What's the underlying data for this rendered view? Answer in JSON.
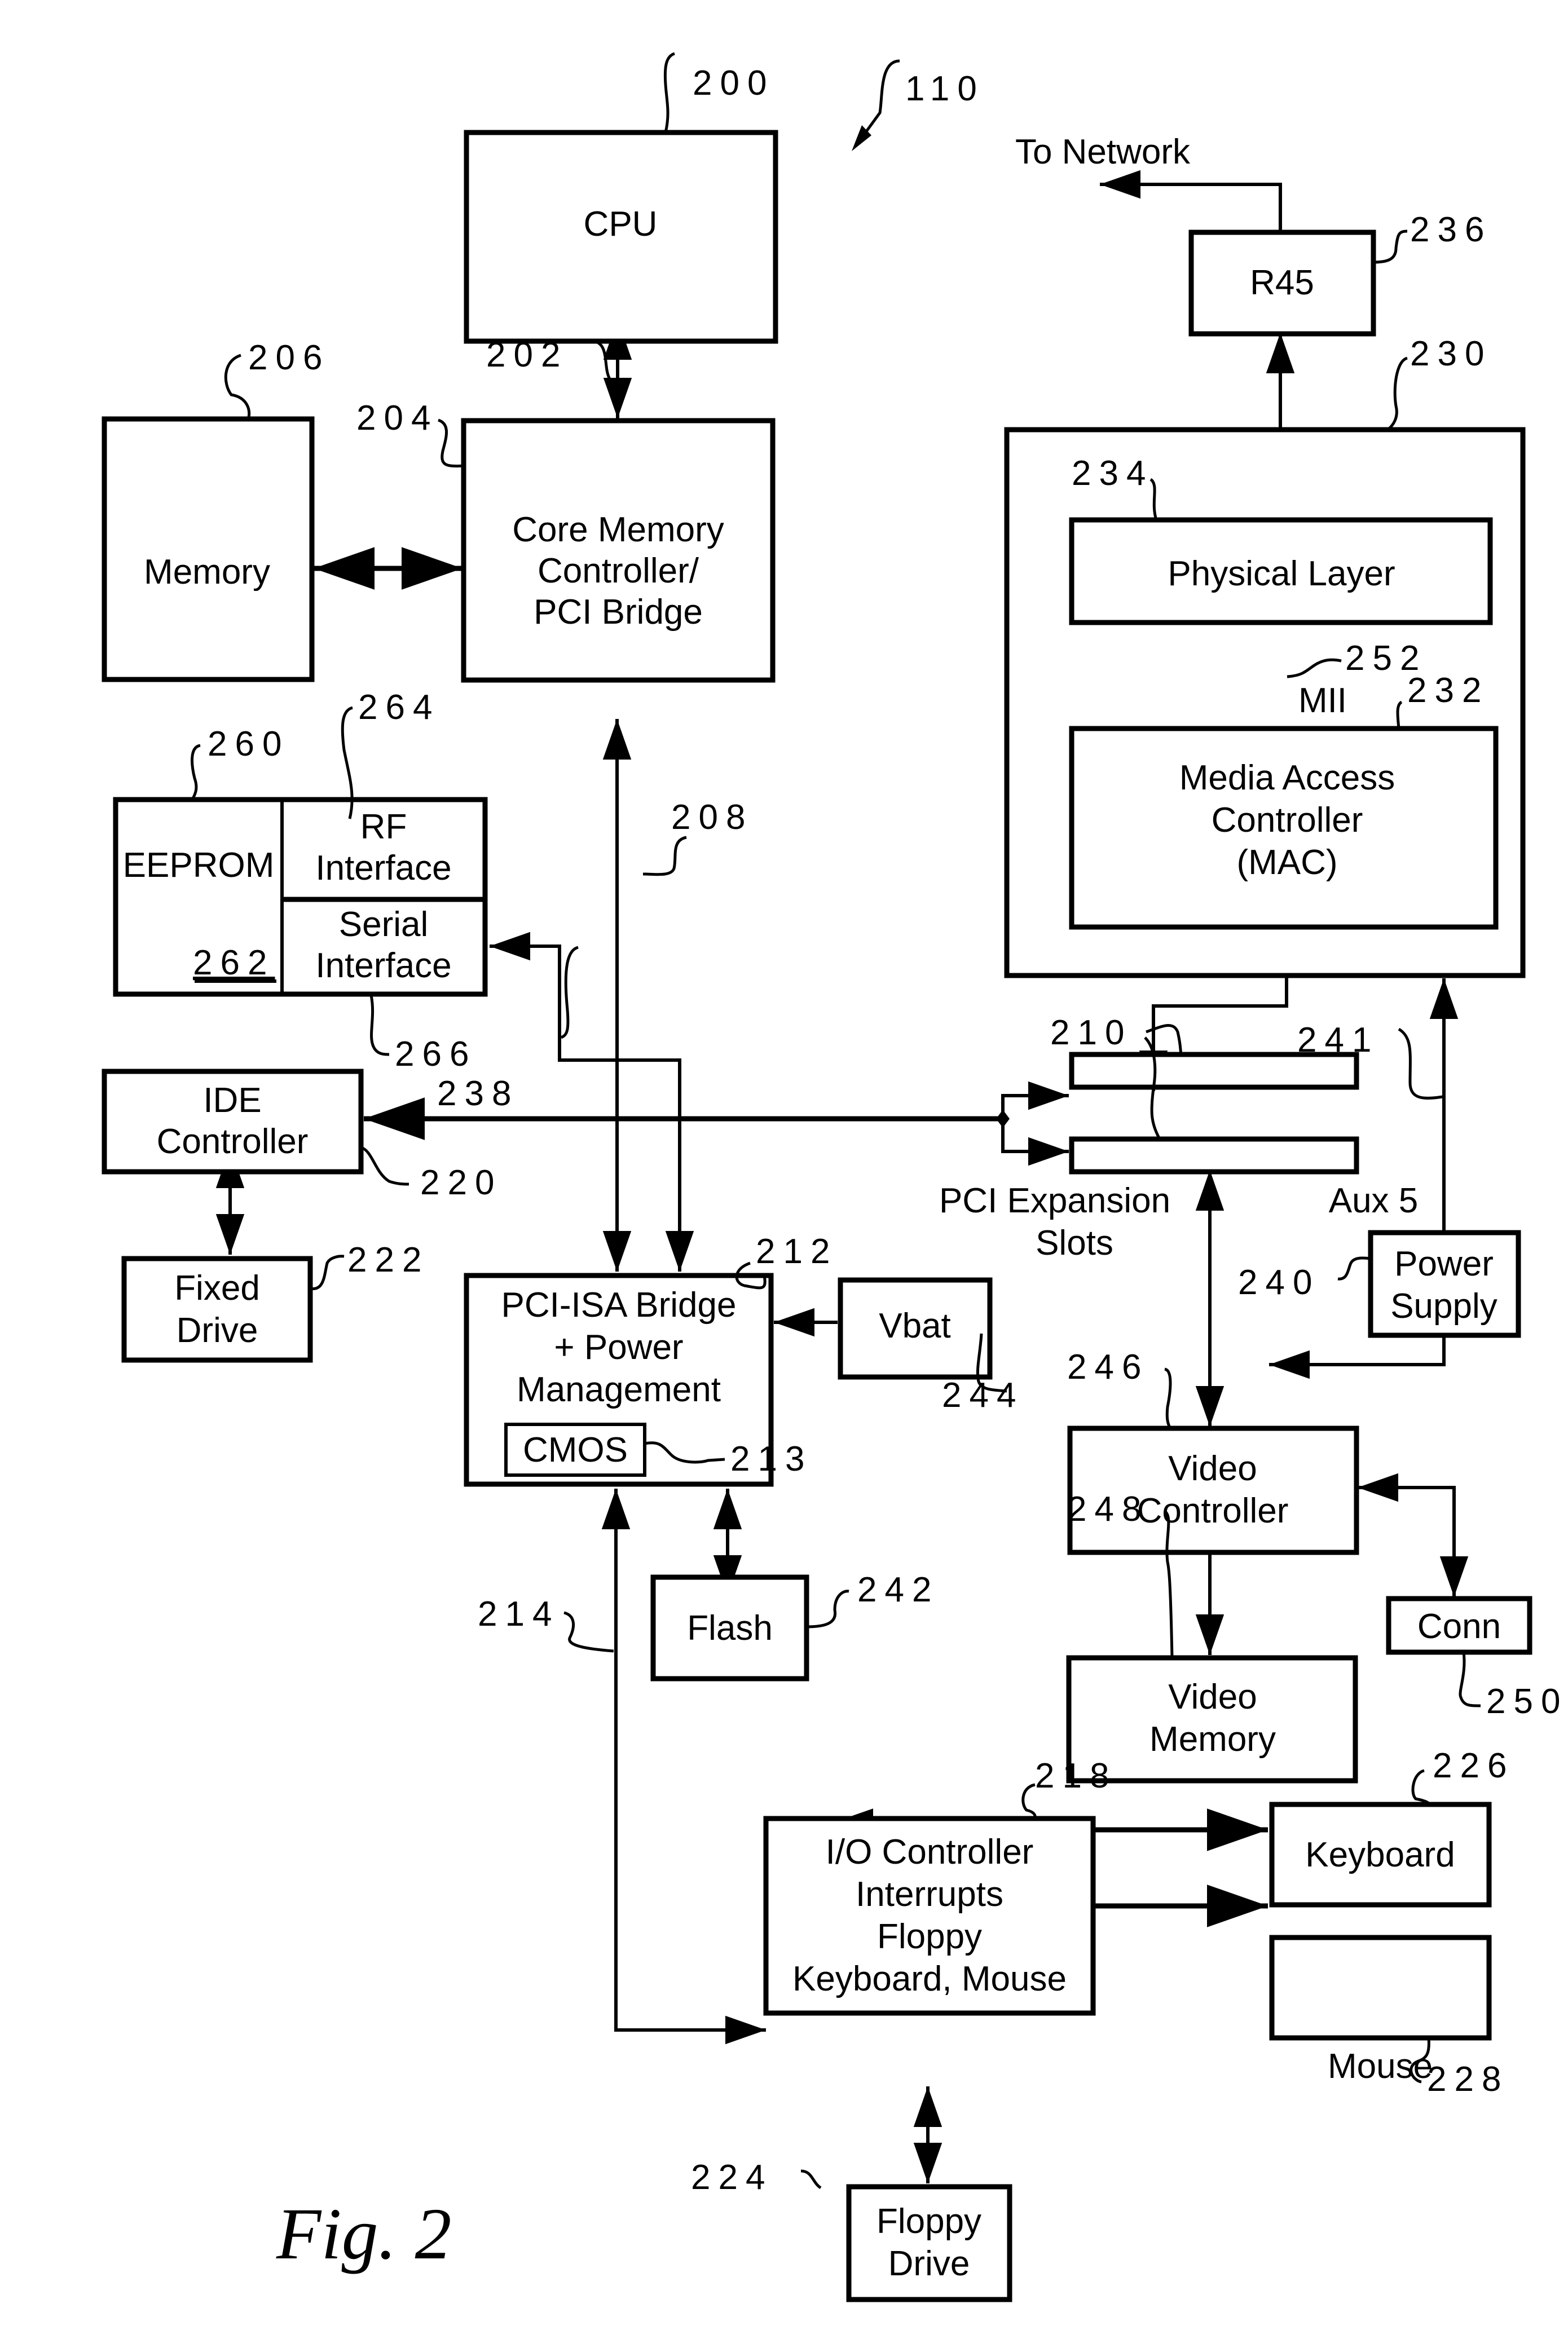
{
  "figure": {
    "caption": "Fig.  2",
    "system_ref": "110"
  },
  "blocks": {
    "cpu": {
      "label": [
        "CPU"
      ],
      "ref": "200"
    },
    "core_memory_controller": {
      "label": [
        "Core Memory",
        "Controller/",
        "PCI Bridge"
      ],
      "ref": "204"
    },
    "memory": {
      "label": [
        "Memory"
      ],
      "ref": "206"
    },
    "eeprom": {
      "label": [
        "EEPROM"
      ],
      "ref": "260",
      "sub_ref": "262"
    },
    "rf_interface": {
      "label": [
        "RF",
        "Interface"
      ],
      "ref": "264"
    },
    "serial_interface": {
      "label": [
        "Serial",
        "Interface"
      ],
      "ref": "266"
    },
    "ide_controller": {
      "label": [
        "IDE",
        "Controller"
      ],
      "ref": "220"
    },
    "fixed_drive": {
      "label": [
        "Fixed",
        "Drive"
      ],
      "ref": "222"
    },
    "pci_isa_bridge": {
      "label": [
        "PCI-ISA Bridge",
        "+ Power",
        "Management"
      ],
      "ref": "212"
    },
    "cmos": {
      "label": [
        "CMOS"
      ],
      "ref": "213"
    },
    "vbat": {
      "label": [
        "Vbat"
      ],
      "ref": "244"
    },
    "flash": {
      "label": [
        "Flash"
      ],
      "ref": "242"
    },
    "io_controller": {
      "label": [
        "I/O Controller",
        "Interrupts",
        "Floppy",
        "Keyboard, Mouse"
      ],
      "ref": "218"
    },
    "floppy_drive": {
      "label": [
        "Floppy",
        "Drive"
      ],
      "ref": "224"
    },
    "keyboard": {
      "label": [
        "Keyboard"
      ],
      "ref": "226"
    },
    "mouse": {
      "label": [
        "Mouse"
      ],
      "ref": "228"
    },
    "r45": {
      "label": [
        "R45"
      ],
      "ref": "236"
    },
    "network_adapter": {
      "label": [],
      "ref": "230"
    },
    "physical_layer": {
      "label": [
        "Physical Layer"
      ],
      "ref": "234"
    },
    "mac": {
      "label": [
        "Media Access",
        "Controller",
        "(MAC)"
      ],
      "ref": "232"
    },
    "pci_expansion_slots": {
      "label": [
        "PCI Expansion",
        "Slots"
      ],
      "ref": "210"
    },
    "power_supply": {
      "label": [
        "Power",
        "Supply"
      ],
      "ref": "240"
    },
    "video_controller": {
      "label": [
        "Video",
        "Controller"
      ],
      "ref": "246"
    },
    "video_memory": {
      "label": [
        "Video",
        "Memory"
      ],
      "ref": "248"
    },
    "conn": {
      "label": [
        "Conn"
      ],
      "ref": "250"
    }
  },
  "connections": {
    "to_network": {
      "label": "To Network"
    },
    "host_bus": {
      "ref": "202"
    },
    "pci_bus": {
      "ref": "208"
    },
    "isa_bus": {
      "ref": "214"
    },
    "serial_link": {
      "ref": "238"
    },
    "aux5": {
      "label": "Aux 5",
      "ref": "241"
    },
    "mii": {
      "label": "MII",
      "ref": "252"
    }
  }
}
